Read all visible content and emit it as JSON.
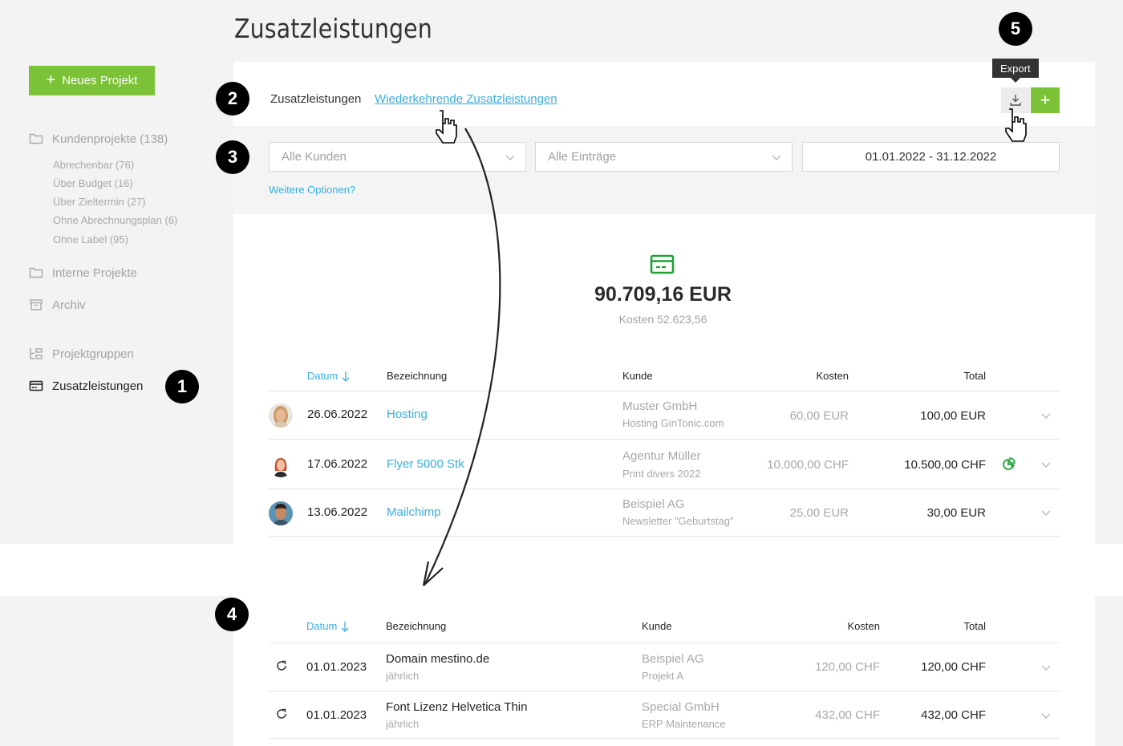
{
  "page": {
    "title": "Zusatzleistungen"
  },
  "sidebar": {
    "new_project_label": "Neues Projekt",
    "items": [
      {
        "label": "Kundenprojekte (138)",
        "icon": "folder-icon"
      },
      {
        "label": "Interne Projekte",
        "icon": "folder-icon"
      },
      {
        "label": "Archiv",
        "icon": "archive-icon"
      },
      {
        "label": "Projektgruppen",
        "icon": "project-groups-icon"
      },
      {
        "label": "Zusatzleistungen",
        "icon": "credit-card-icon",
        "active": true
      }
    ],
    "subitems": [
      {
        "label": "Abrechenbar (76)"
      },
      {
        "label": "Über Budget (16)"
      },
      {
        "label": "Über Zieltermin (27)"
      },
      {
        "label": "Ohne Abrechnungsplan (6)"
      },
      {
        "label": "Ohne Label (95)"
      }
    ]
  },
  "tabs": {
    "current": "Zusatzleistungen",
    "recurring_link": "Wiederkehrende Zusatzleistungen"
  },
  "toolbar": {
    "export_tooltip": "Export",
    "export_icon": "download-icon",
    "add_label": "+"
  },
  "filters": {
    "customer_select": "Alle Kunden",
    "entries_select": "Alle Einträge",
    "date_range": "01.01.2022 - 31.12.2022",
    "more_options": "Weitere Optionen?"
  },
  "summary": {
    "total": "90.709,16 EUR",
    "costs": "Kosten 52.623,56",
    "accent": "#21a038"
  },
  "services_table": {
    "headers": {
      "date": "Datum",
      "title": "Bezeichnung",
      "customer": "Kunde",
      "costs": "Kosten",
      "total": "Total"
    },
    "rows": [
      {
        "avatar": "avatar-woman-blonde",
        "date": "26.06.2022",
        "title": "Hosting",
        "customer": "Muster GmbH",
        "project": "Hosting GinTonic.com",
        "costs": "60,00 EUR",
        "total": "100,00 EUR",
        "budget_icon": false
      },
      {
        "avatar": "avatar-woman-red",
        "date": "17.06.2022",
        "title": "Flyer 5000 Stk",
        "customer": "Agentur Müller",
        "project": "Print divers 2022",
        "costs": "10.000,00 CHF",
        "total": "10.500,00 CHF",
        "budget_icon": true
      },
      {
        "avatar": "avatar-man",
        "date": "13.06.2022",
        "title": "Mailchimp",
        "customer": "Beispiel AG",
        "project": "Newsletter \"Geburtstag\"",
        "costs": "25,00 EUR",
        "total": "30,00 EUR",
        "budget_icon": false
      }
    ]
  },
  "recurring_table": {
    "headers": {
      "date": "Datum",
      "title": "Bezeichnung",
      "customer": "Kunde",
      "costs": "Kosten",
      "total": "Total"
    },
    "rows": [
      {
        "date": "01.01.2023",
        "title": "Domain mestino.de",
        "interval": "jährlich",
        "customer": "Beispiel AG",
        "project": "Projekt A",
        "costs": "120,00 CHF",
        "total": "120,00 CHF"
      },
      {
        "date": "01.01.2023",
        "title": "Font Lizenz Helvetica Thin",
        "interval": "jährlich",
        "customer": "Special GmbH",
        "project": "ERP Maintenance",
        "costs": "432,00 CHF",
        "total": "432,00 CHF"
      }
    ]
  },
  "annotations": [
    "1",
    "2",
    "3",
    "4",
    "5"
  ],
  "colors": {
    "brand_green": "#7bc237",
    "link_blue": "#3aaee2",
    "muted": "#a8a8a8"
  }
}
